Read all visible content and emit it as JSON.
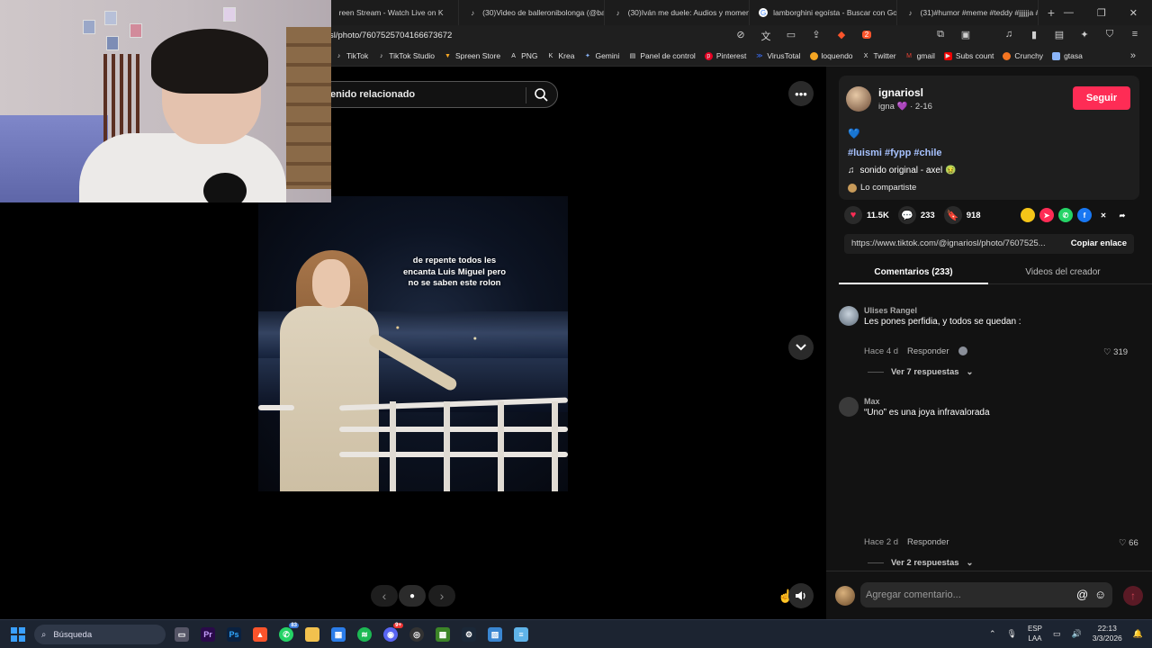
{
  "browser": {
    "tabs": [
      {
        "title": "reen Stream - Watch Live on K"
      },
      {
        "title": "(30)Video de balleronibolonga (@ba"
      },
      {
        "title": "(30)Iván me duele: Audios y moment"
      },
      {
        "title": "lamborghini egoísta - Buscar con Go"
      },
      {
        "title": "(31)#humor #meme #teddy #jjjjjja #"
      }
    ],
    "new_tab_label": "+",
    "url": "sl/photo/7607525704166673672",
    "bookmarks": [
      {
        "label": "TikTok"
      },
      {
        "label": "TikTok Studio"
      },
      {
        "label": "Spreen Store"
      },
      {
        "label": "PNG"
      },
      {
        "label": "Krea"
      },
      {
        "label": "Gemini"
      },
      {
        "label": "Panel de control"
      },
      {
        "label": "Pinterest"
      },
      {
        "label": "VirusTotal"
      },
      {
        "label": "loquendo"
      },
      {
        "label": "Twitter"
      },
      {
        "label": "gmail"
      },
      {
        "label": "Subs count"
      },
      {
        "label": "Crunchy"
      },
      {
        "label": "gtasa"
      }
    ],
    "extension_badge": "2"
  },
  "stage": {
    "search_text": "enido relacionado",
    "photo_caption_lines": [
      "de repente todos les",
      "encanta Luis Miguel pero",
      "no se saben este rolon"
    ]
  },
  "panel": {
    "author": {
      "username": "ignariosl",
      "display_name": "igna 💜",
      "date": "· 2-16",
      "follow_label": "Seguir"
    },
    "description_emoji": "💙",
    "hashtags": "#luismi #fypp #chile",
    "music": "sonido original - axel 🤢",
    "shared_label": "Lo compartiste",
    "stats": {
      "likes": "11.5K",
      "comments": "233",
      "saves": "918"
    },
    "link": "https://www.tiktok.com/@ignariosl/photo/7607525...",
    "copy_label": "Copiar enlace",
    "tab_comments": "Comentarios (233)",
    "tab_videos": "Videos del creador",
    "comments": [
      {
        "name": "Ulises Rangel",
        "text": "Les pones perfidia, y todos se quedan :",
        "time": "Hace 4 d",
        "reply": "Responder",
        "likes": "319",
        "replies": "Ver 7 respuestas"
      },
      {
        "name": "Max",
        "text": "“Uno” es una joya infravalorada",
        "time": "Hace 2 d",
        "reply": "Responder",
        "likes": "66",
        "replies": "Ver 2 respuestas"
      }
    ],
    "comment_placeholder": "Agregar comentario..."
  },
  "taskbar": {
    "search_label": "Búsqueda",
    "whatsapp_badge": "83",
    "discord_badge": "9+",
    "lang_top": "ESP",
    "lang_bottom": "LAA",
    "time": "22:13",
    "date": "3/3/2026"
  },
  "colors": {
    "accent": "#fe2c55",
    "hashtag": "#a7c2ff",
    "panel_bg": "#121212"
  }
}
